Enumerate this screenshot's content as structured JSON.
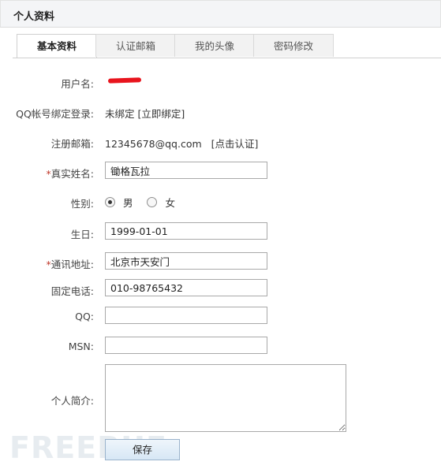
{
  "header": {
    "title": "个人资料"
  },
  "tabs": [
    {
      "label": "基本资料",
      "active": true
    },
    {
      "label": "认证邮箱",
      "active": false
    },
    {
      "label": "我的头像",
      "active": false
    },
    {
      "label": "密码修改",
      "active": false
    }
  ],
  "form": {
    "username": {
      "label": "用户名:"
    },
    "qq_bind": {
      "label": "QQ帐号绑定登录:",
      "status": "未绑定",
      "action": "[立即绑定]"
    },
    "email": {
      "label": "注册邮箱:",
      "value": "12345678@qq.com",
      "action": "[点击认证]"
    },
    "real_name": {
      "required_mark": "*",
      "label": "真实姓名:",
      "value": "锄格瓦拉"
    },
    "gender": {
      "label": "性别:",
      "options": [
        "男",
        "女"
      ],
      "selected": "男"
    },
    "birthday": {
      "label": "生日:",
      "value": "1999-01-01"
    },
    "address": {
      "required_mark": "*",
      "label": "通讯地址:",
      "value": "北京市天安门"
    },
    "phone": {
      "label": "固定电话:",
      "value": "010-98765432"
    },
    "qq": {
      "label": "QQ:",
      "value": ""
    },
    "msn": {
      "label": "MSN:",
      "value": ""
    },
    "bio": {
      "label": "个人简介:",
      "value": ""
    },
    "save_label": "保存"
  },
  "watermark": "FREEBUF",
  "colors": {
    "required": "#c0392b",
    "redaction": "#e8141d"
  }
}
